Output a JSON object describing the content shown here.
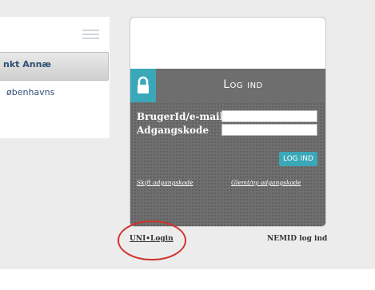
{
  "left_panel": {
    "menu_icon": "hamburger-menu-icon",
    "tab_label": "nkt Annæ",
    "link_label": "øbenhavns"
  },
  "login": {
    "title": "Log ind",
    "lock_icon": "padlock-icon",
    "username_label": "BrugerId/e-mail",
    "password_label": "Adgangskode",
    "username_value": "",
    "password_value": "",
    "login_button_label": "LOG IND",
    "change_password_link": "Skift adgangskode",
    "forgot_password_link": "Glemt/ny adgangskode"
  },
  "below": {
    "uni_login_link": "UNI•Login",
    "nemid_link": "NEMID log ind"
  },
  "colors": {
    "accent": "#3aa8b9",
    "card_bg": "#6b6b6b",
    "annotation": "#d0312d"
  }
}
